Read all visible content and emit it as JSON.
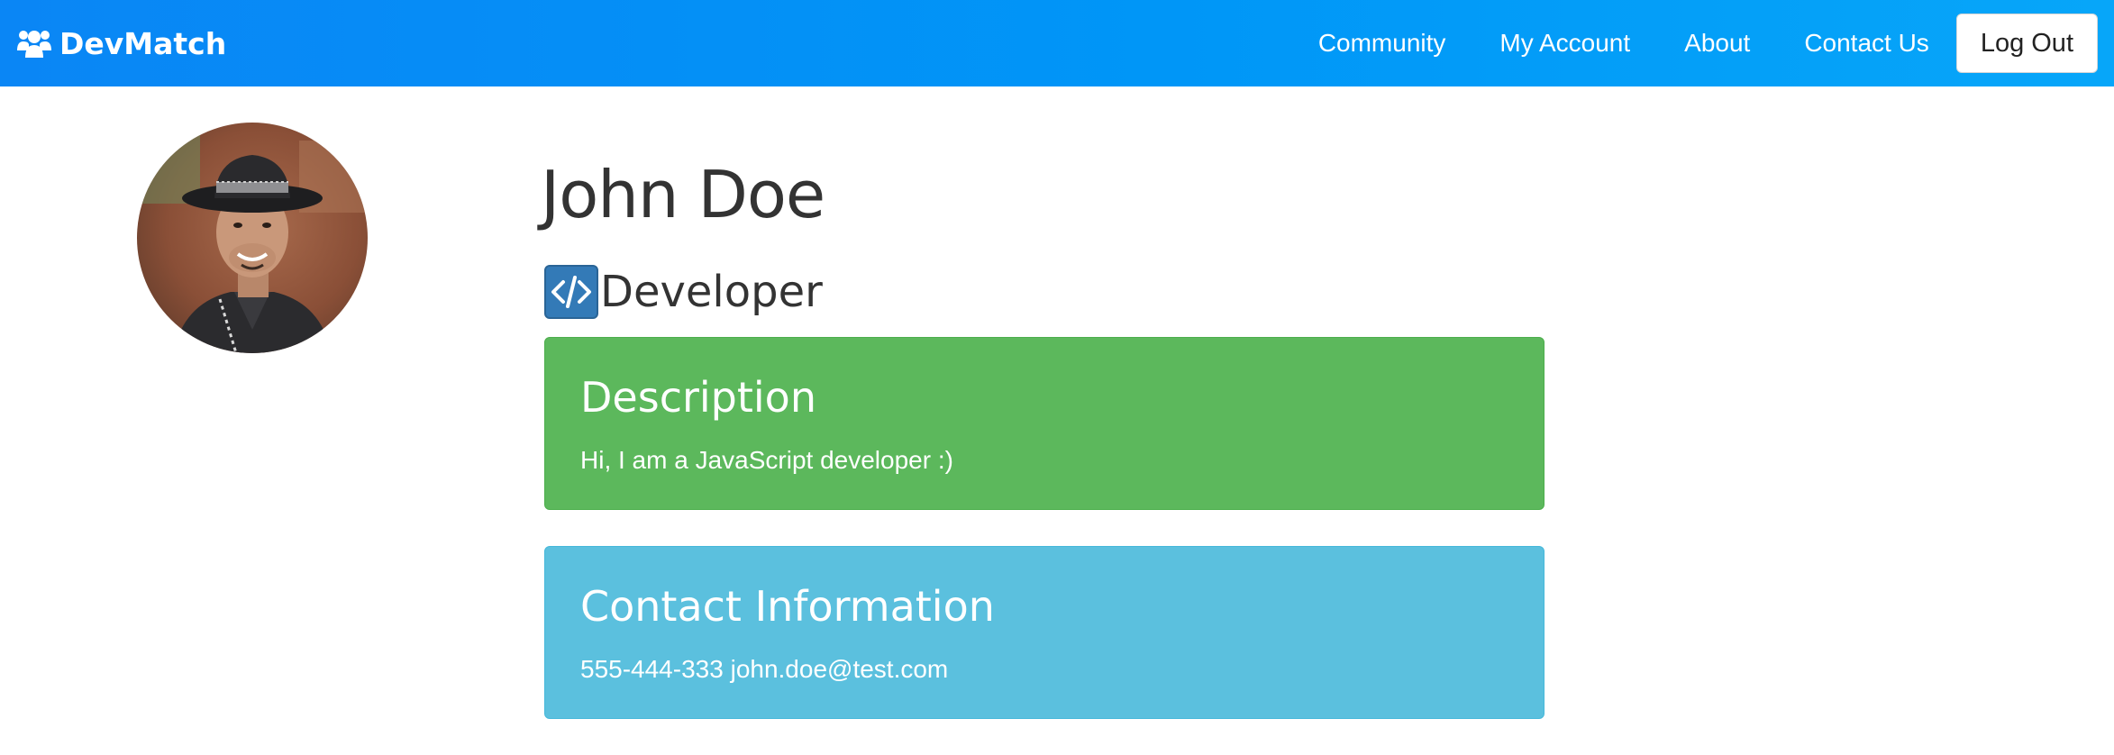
{
  "navbar": {
    "brand": "DevMatch",
    "brand_icon": "users-icon",
    "links": [
      "Community",
      "My Account",
      "About",
      "Contact Us"
    ],
    "logout_label": "Log Out",
    "gradient_colors": [
      "#0a86f5",
      "#07a6f9"
    ]
  },
  "profile": {
    "name": "John Doe",
    "role": "Developer",
    "role_icon": "code-icon",
    "avatar": "profile-photo"
  },
  "description": {
    "title": "Description",
    "text": "Hi, I am a JavaScript developer :)",
    "color": "#5cb85c"
  },
  "contact": {
    "title": "Contact Information",
    "phone": "555-444-333",
    "email": "john.doe@test.com",
    "color": "#5bc0de"
  }
}
